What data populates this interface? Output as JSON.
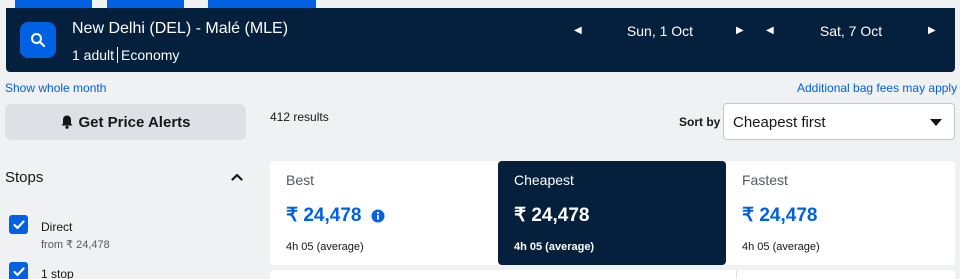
{
  "search": {
    "route": "New Delhi (DEL) - Malé (MLE)",
    "passengers": "1 adult",
    "cabin": "Economy",
    "outbound_date": "Sun, 1 Oct",
    "return_date": "Sat, 7 Oct"
  },
  "links": {
    "show_whole_month": "Show whole month",
    "bag_fees": "Additional bag fees may apply"
  },
  "sidebar": {
    "price_alerts_label": "Get Price Alerts",
    "stops_title": "Stops",
    "stops": [
      {
        "label": "Direct",
        "sub": "from ₹ 24,478",
        "checked": true
      },
      {
        "label": "1 stop",
        "sub": "",
        "checked": true
      }
    ]
  },
  "results": {
    "count_text": "412 results",
    "sort_label": "Sort by",
    "sort_value": "Cheapest first"
  },
  "tabs": [
    {
      "title": "Best",
      "price": "₹ 24,478",
      "duration": "4h 05 (average)",
      "active": false
    },
    {
      "title": "Cheapest",
      "price": "₹ 24,478",
      "duration": "4h 05 (average)",
      "active": true
    },
    {
      "title": "Fastest",
      "price": "₹ 24,478",
      "duration": "4h 05 (average)",
      "active": false
    }
  ],
  "colors": {
    "navy": "#05203c",
    "accent": "#0062e3",
    "background": "#eff1f2"
  },
  "icons": [
    "search-icon",
    "chevron-left-icon",
    "chevron-right-icon",
    "bell-icon",
    "chevron-up-icon",
    "check-icon",
    "info-icon",
    "caret-down-icon"
  ]
}
